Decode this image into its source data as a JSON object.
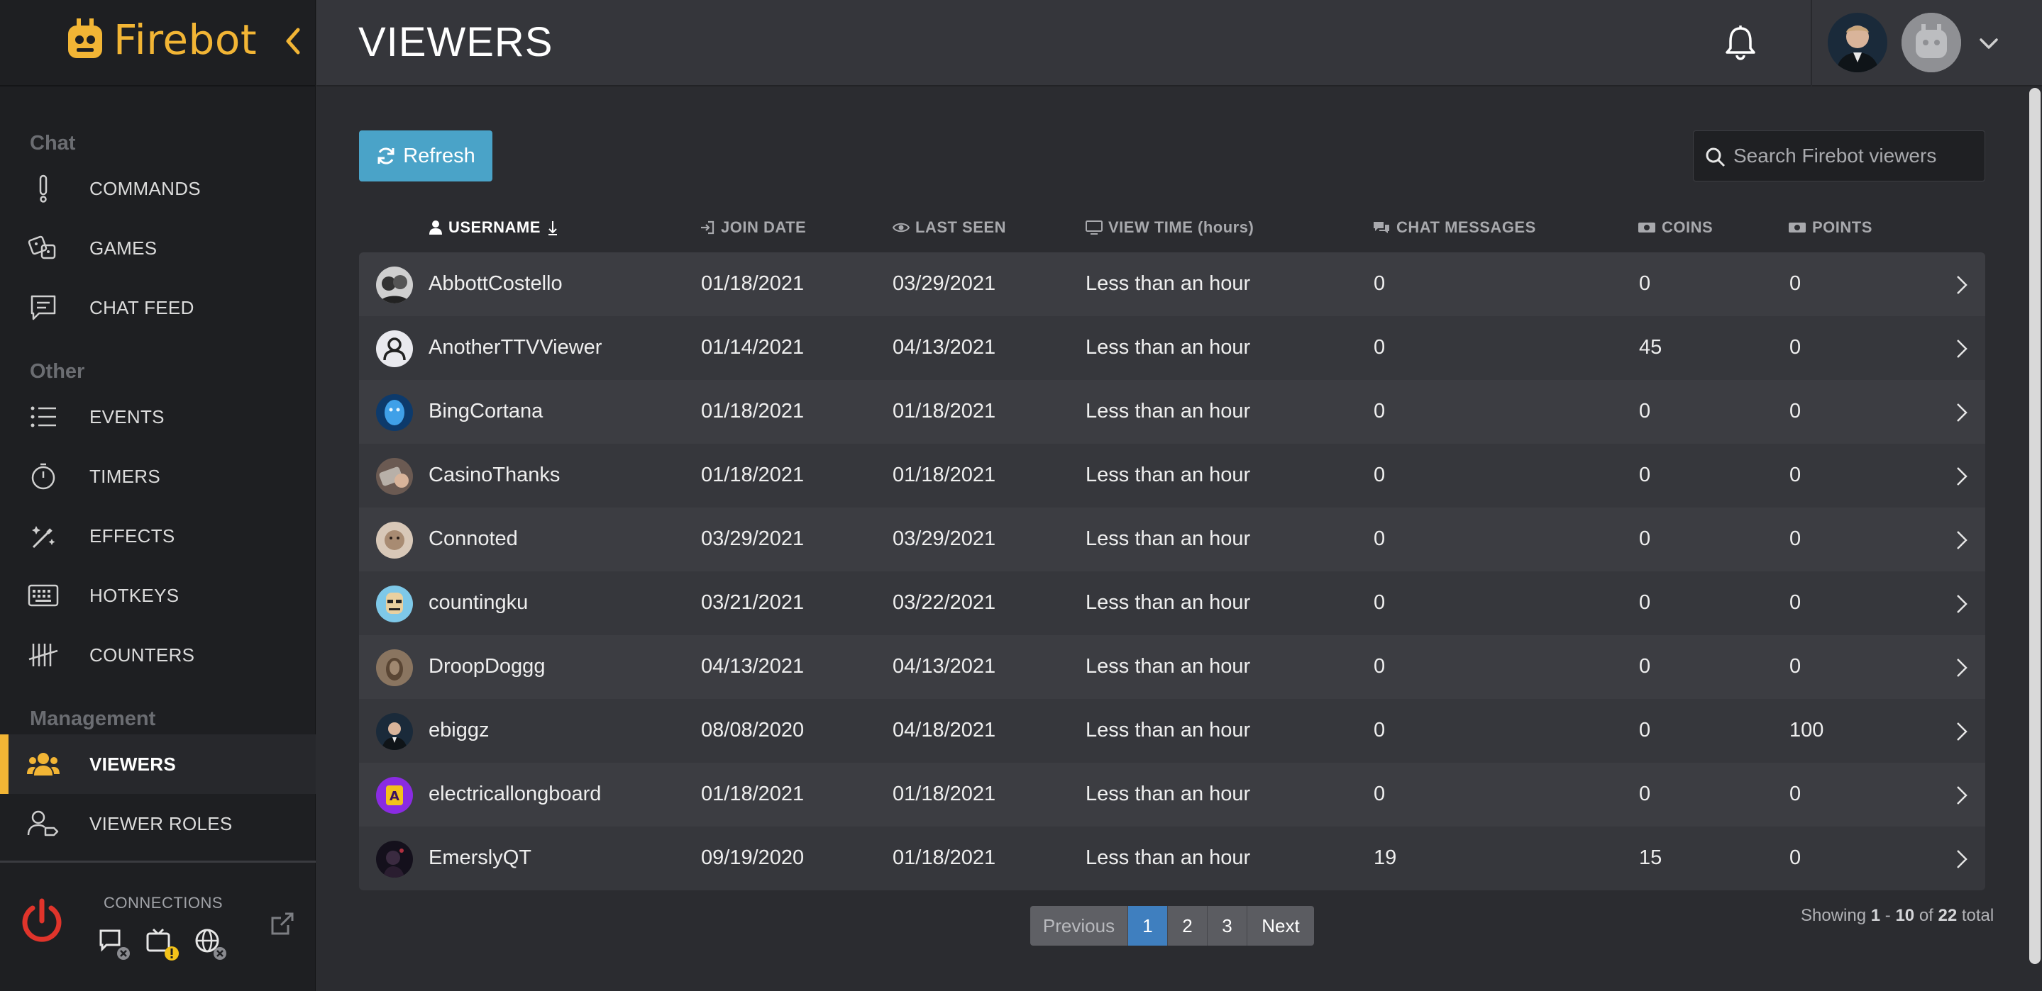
{
  "app": {
    "name": "Firebot"
  },
  "header": {
    "title": "VIEWERS"
  },
  "sidebar": {
    "sections": [
      {
        "label": "Chat"
      },
      {
        "label": "Other"
      },
      {
        "label": "Management"
      }
    ],
    "items": [
      {
        "label": "COMMANDS",
        "icon": "exclamation-icon"
      },
      {
        "label": "GAMES",
        "icon": "dice-icon"
      },
      {
        "label": "CHAT FEED",
        "icon": "chat-icon"
      },
      {
        "label": "EVENTS",
        "icon": "list-icon"
      },
      {
        "label": "TIMERS",
        "icon": "stopwatch-icon"
      },
      {
        "label": "EFFECTS",
        "icon": "magic-wand-icon"
      },
      {
        "label": "HOTKEYS",
        "icon": "keyboard-icon"
      },
      {
        "label": "COUNTERS",
        "icon": "tally-icon"
      },
      {
        "label": "VIEWERS",
        "icon": "users-icon",
        "active": true
      },
      {
        "label": "VIEWER ROLES",
        "icon": "user-tag-icon"
      }
    ],
    "connections_label": "CONNECTIONS"
  },
  "toolbar": {
    "refresh_label": "Refresh",
    "search_placeholder": "Search Firebot viewers"
  },
  "table": {
    "columns": [
      {
        "label": "USERNAME",
        "icon": "user-icon",
        "sorted": true
      },
      {
        "label": "JOIN DATE",
        "icon": "sign-in-icon"
      },
      {
        "label": "LAST SEEN",
        "icon": "eye-icon"
      },
      {
        "label": "VIEW TIME (hours)",
        "icon": "monitor-icon"
      },
      {
        "label": "CHAT MESSAGES",
        "icon": "comments-icon"
      },
      {
        "label": "COINS",
        "icon": "money-icon"
      },
      {
        "label": "POINTS",
        "icon": "money-icon"
      }
    ],
    "rows": [
      {
        "username": "AbbottCostello",
        "join": "01/18/2021",
        "seen": "03/29/2021",
        "viewtime": "Less than an hour",
        "chat": "0",
        "coins": "0",
        "points": "0"
      },
      {
        "username": "AnotherTTVViewer",
        "join": "01/14/2021",
        "seen": "04/13/2021",
        "viewtime": "Less than an hour",
        "chat": "0",
        "coins": "45",
        "points": "0"
      },
      {
        "username": "BingCortana",
        "join": "01/18/2021",
        "seen": "01/18/2021",
        "viewtime": "Less than an hour",
        "chat": "0",
        "coins": "0",
        "points": "0"
      },
      {
        "username": "CasinoThanks",
        "join": "01/18/2021",
        "seen": "01/18/2021",
        "viewtime": "Less than an hour",
        "chat": "0",
        "coins": "0",
        "points": "0"
      },
      {
        "username": "Connoted",
        "join": "03/29/2021",
        "seen": "03/29/2021",
        "viewtime": "Less than an hour",
        "chat": "0",
        "coins": "0",
        "points": "0"
      },
      {
        "username": "countingku",
        "join": "03/21/2021",
        "seen": "03/22/2021",
        "viewtime": "Less than an hour",
        "chat": "0",
        "coins": "0",
        "points": "0"
      },
      {
        "username": "DroopDoggg",
        "join": "04/13/2021",
        "seen": "04/13/2021",
        "viewtime": "Less than an hour",
        "chat": "0",
        "coins": "0",
        "points": "0"
      },
      {
        "username": "ebiggz",
        "join": "08/08/2020",
        "seen": "04/18/2021",
        "viewtime": "Less than an hour",
        "chat": "0",
        "coins": "0",
        "points": "100"
      },
      {
        "username": "electricallongboard",
        "join": "01/18/2021",
        "seen": "01/18/2021",
        "viewtime": "Less than an hour",
        "chat": "0",
        "coins": "0",
        "points": "0"
      },
      {
        "username": "EmerslyQT",
        "join": "09/19/2020",
        "seen": "01/18/2021",
        "viewtime": "Less than an hour",
        "chat": "19",
        "coins": "15",
        "points": "0"
      }
    ]
  },
  "pagination": {
    "previous": "Previous",
    "pages": [
      "1",
      "2",
      "3"
    ],
    "current": "1",
    "next": "Next",
    "showing_prefix": "Showing",
    "range_start": "1",
    "range_sep": "-",
    "range_end": "10",
    "of_word": "of",
    "total": "22",
    "total_word": "total"
  },
  "colors": {
    "accent": "#f2b535",
    "refresh": "#4aa3c8",
    "active_page": "#3f7fbf",
    "power": "#e0342b"
  }
}
